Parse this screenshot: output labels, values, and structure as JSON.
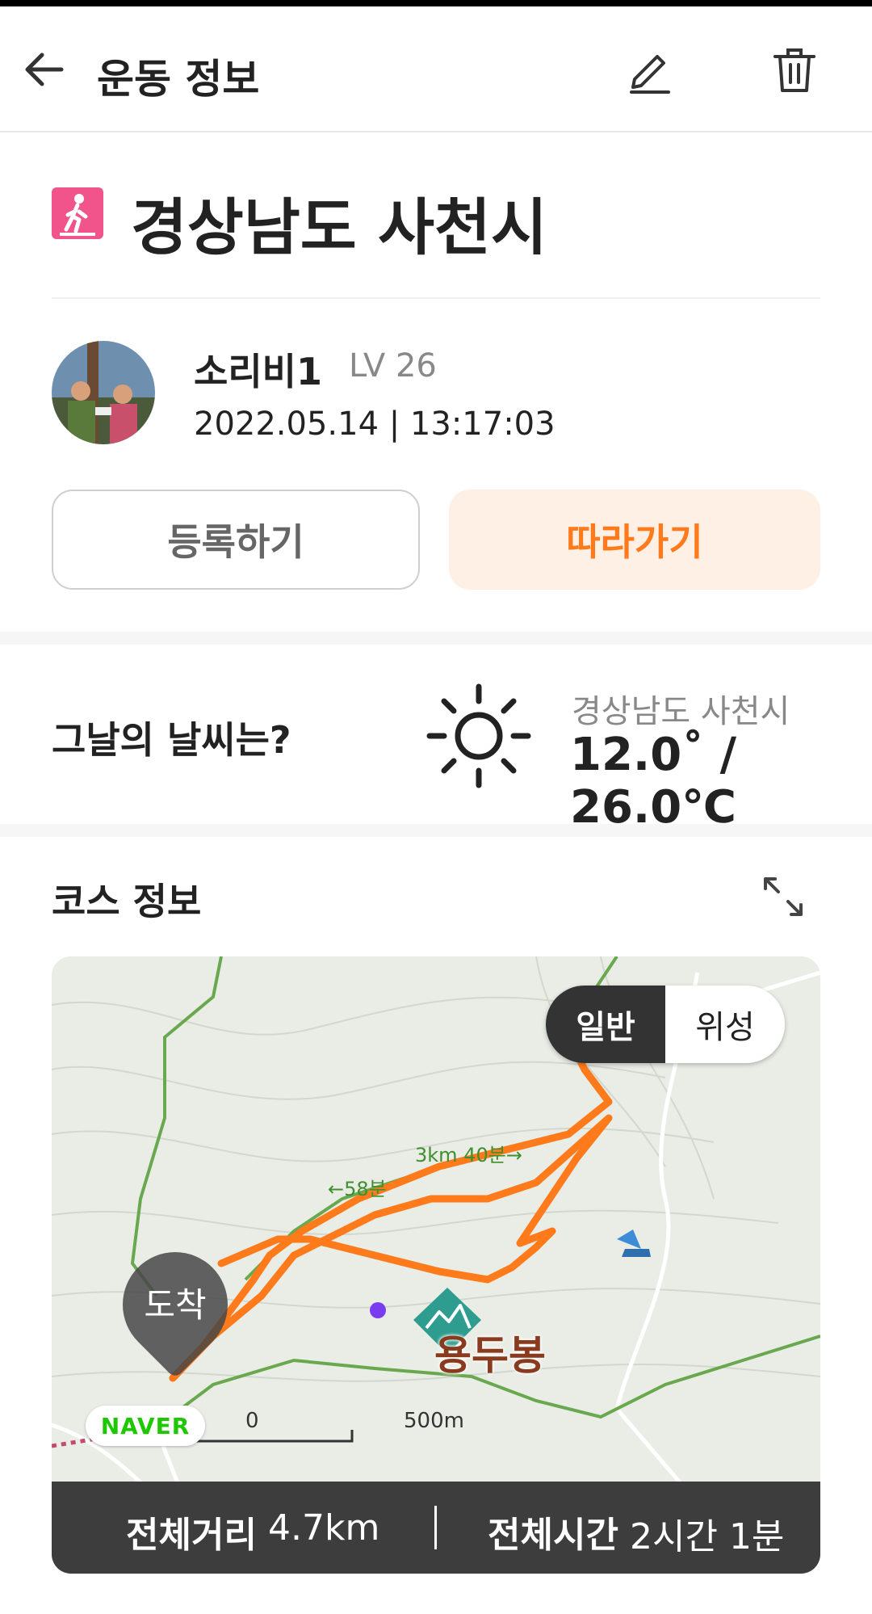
{
  "header": {
    "title": "운동 정보",
    "back_icon": "arrow-left-icon",
    "edit_icon": "pencil-icon",
    "delete_icon": "trash-icon"
  },
  "activity": {
    "type_icon": "walking-person-icon",
    "type_color": "#f0548a",
    "place": "경상남도 사천시"
  },
  "user": {
    "name": "소리비1",
    "level": "LV 26",
    "datetime": "2022.05.14 | 13:17:03"
  },
  "actions": {
    "register_label": "등록하기",
    "follow_label": "따라가기",
    "accent_color": "#ff7a1a"
  },
  "weather": {
    "question": "그날의 날씨는?",
    "icon": "sun-icon",
    "location": "경상남도 사천시",
    "temperature": "12.0˚ / 26.0℃"
  },
  "course": {
    "title": "코스 정보",
    "expand_icon": "expand-icon",
    "map": {
      "toggle_normal": "일반",
      "toggle_satellite": "위성",
      "selected": "일반",
      "arrive_label": "도착",
      "peak_label": "용두봉",
      "naver_logo": "NAVER",
      "scale_start": "0",
      "scale_end": "500m",
      "trail_label_1": "3km 40분→",
      "trail_label_2": "←58분",
      "route_color": "#ff7a1a"
    },
    "summary": {
      "distance_label": "전체거리",
      "distance_value": "4.7km",
      "time_label": "전체시간",
      "time_value": "2시간 1분"
    }
  }
}
